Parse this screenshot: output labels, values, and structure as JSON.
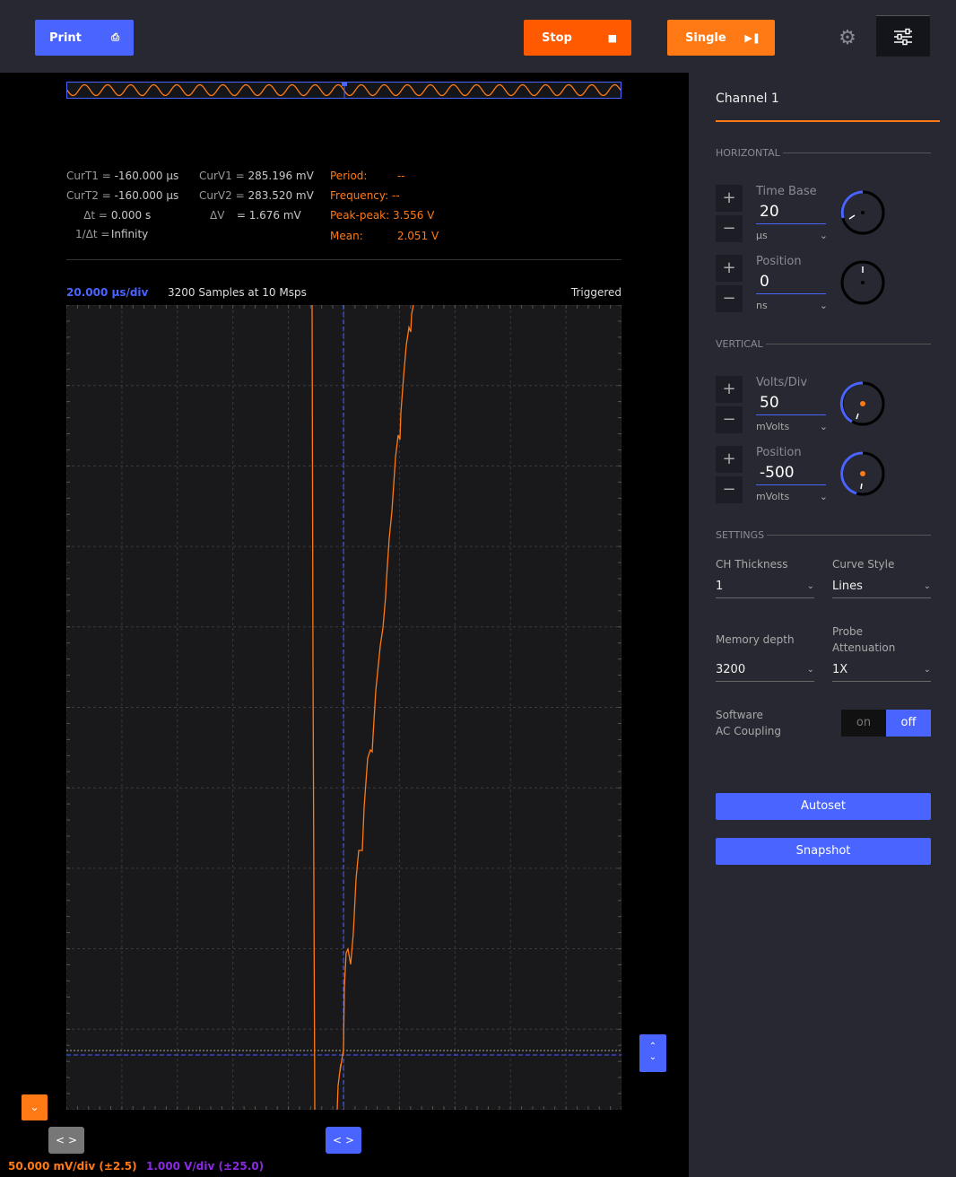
{
  "toolbar": {
    "print_label": "Print",
    "stop_label": "Stop",
    "single_label": "Single"
  },
  "measurements": {
    "curt1_label": "CurT1 =",
    "curt1_value": "-160.000 µs",
    "curt2_label": "CurT2 =",
    "curt2_value": "-160.000 µs",
    "dt_label": "Δt =",
    "dt_value": "0.000 s",
    "inv_dt_label": "1/Δt =",
    "inv_dt_value": "Infinity",
    "curv1_label": "CurV1 =",
    "curv1_value": "285.196 mV",
    "curv2_label": "CurV2 =",
    "curv2_value": "283.520 mV",
    "dv_label": "ΔV",
    "dv_value": "= 1.676 mV",
    "period_label": "Period:",
    "period_value": "--",
    "frequency_label": "Frequency:",
    "frequency_value": "--",
    "peakpeak_label": "Peak-peak:",
    "peakpeak_value": "3.556 V",
    "mean_label": "Mean:",
    "mean_value": "2.051 V"
  },
  "scope": {
    "time_div": "20.000 µs/div",
    "samples": "3200 Samples at 10 Msps",
    "status": "Triggered",
    "ch1_scale": "50.000 mV/div (±2.5)",
    "ch2_scale": "1.000 V/div (±25.0)"
  },
  "panel": {
    "title": "Channel 1",
    "horizontal_label": "HORIZONTAL",
    "vertical_label": "VERTICAL",
    "settings_label": "SETTINGS",
    "time_base": {
      "label": "Time Base",
      "value": "20",
      "unit": "µs"
    },
    "h_position": {
      "label": "Position",
      "value": "0",
      "unit": "ns"
    },
    "volts_div": {
      "label": "Volts/Div",
      "value": "50",
      "unit": "mVolts"
    },
    "v_position": {
      "label": "Position",
      "value": "-500",
      "unit": "mVolts"
    },
    "ch_thickness": {
      "label": "CH Thickness",
      "value": "1"
    },
    "curve_style": {
      "label": "Curve Style",
      "value": "Lines"
    },
    "memory_depth": {
      "label": "Memory depth",
      "value": "3200"
    },
    "probe_attenuation": {
      "label": "Probe Attenuation",
      "value": "1X"
    },
    "ac_coupling": {
      "label_line1": "Software",
      "label_line2": "AC Coupling",
      "on_label": "on",
      "off_label": "off"
    },
    "autoset_label": "Autoset",
    "snapshot_label": "Snapshot"
  },
  "colors": {
    "accent_blue": "#4a64ff",
    "accent_orange": "#ff7a14",
    "stop_orange": "#ff5a00",
    "ch2_purple": "#8a2be2"
  }
}
